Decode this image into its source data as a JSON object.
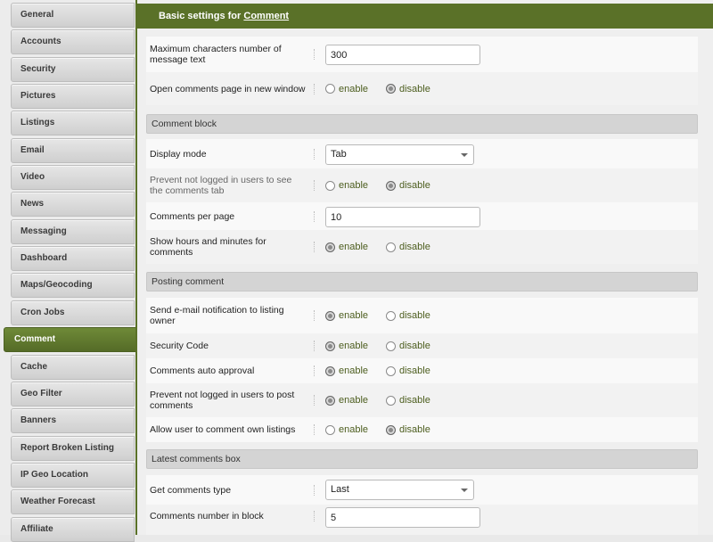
{
  "sidebar": {
    "items": [
      {
        "label": "General"
      },
      {
        "label": "Accounts"
      },
      {
        "label": "Security"
      },
      {
        "label": "Pictures"
      },
      {
        "label": "Listings"
      },
      {
        "label": "Email"
      },
      {
        "label": "Video"
      },
      {
        "label": "News"
      },
      {
        "label": "Messaging"
      },
      {
        "label": "Dashboard"
      },
      {
        "label": "Maps/Geocoding"
      },
      {
        "label": "Cron Jobs"
      },
      {
        "label": "Comment",
        "active": true
      },
      {
        "label": "Cache"
      },
      {
        "label": "Geo Filter"
      },
      {
        "label": "Banners"
      },
      {
        "label": "Report Broken Listing"
      },
      {
        "label": "IP Geo Location"
      },
      {
        "label": "Weather Forecast"
      },
      {
        "label": "Affiliate"
      }
    ]
  },
  "header": {
    "prefix": "Basic settings for",
    "link": "Comment"
  },
  "options": {
    "enable": "enable",
    "disable": "disable"
  },
  "settings": {
    "max_chars": {
      "label": "Maximum characters number of message text",
      "value": "300"
    },
    "open_new_window": {
      "label": "Open comments page in new window",
      "selected": "disable"
    },
    "display_mode": {
      "label": "Display mode",
      "value": "Tab"
    },
    "prevent_not_logged_see": {
      "label": "Prevent not logged in users to see the comments tab",
      "selected": "disable"
    },
    "per_page": {
      "label": "Comments per page",
      "value": "10"
    },
    "show_hours": {
      "label": "Show hours and minutes for comments",
      "selected": "enable"
    },
    "email_notification": {
      "label": "Send e-mail notification to listing owner",
      "selected": "enable"
    },
    "security_code": {
      "label": "Security Code",
      "selected": "enable"
    },
    "auto_approval": {
      "label": "Comments auto approval",
      "selected": "enable"
    },
    "prevent_not_logged_post": {
      "label": "Prevent not logged in users to post comments",
      "selected": "enable"
    },
    "allow_own": {
      "label": "Allow user to comment own listings",
      "selected": "disable"
    },
    "get_type": {
      "label": "Get comments type",
      "value": "Last"
    },
    "number_in_block": {
      "label": "Comments number in block",
      "value": "5"
    }
  },
  "sections": {
    "comment_block": "Comment block",
    "posting_comment": "Posting comment",
    "latest_box": "Latest comments box"
  },
  "colors": {
    "accent": "#5a7128",
    "radio_text": "#4d5e1f"
  }
}
